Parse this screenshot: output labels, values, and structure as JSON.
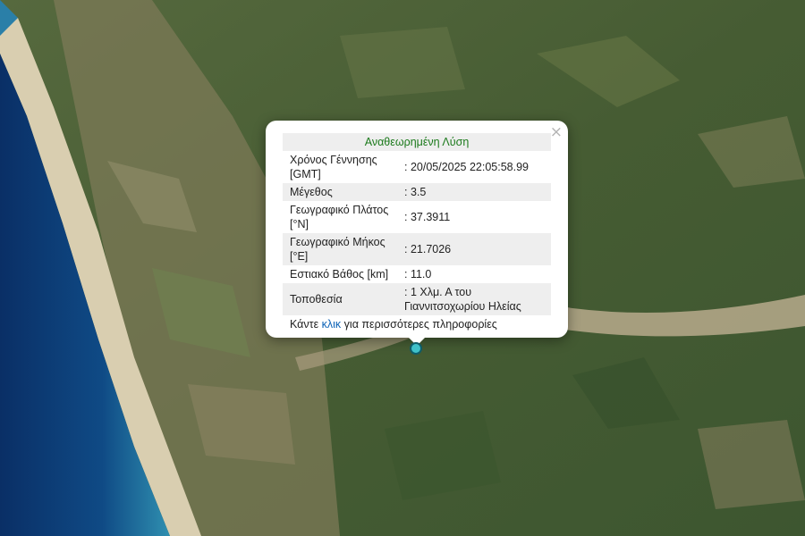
{
  "popup": {
    "title": "Αναθεωρημένη Λύση",
    "close_label": "×",
    "rows": [
      {
        "label": "Χρόνος Γέννησης [GMT]",
        "value": ": 20/05/2025 22:05:58.99"
      },
      {
        "label": "Μέγεθος",
        "value": ": 3.5"
      },
      {
        "label": "Γεωγραφικό Πλάτος [°N]",
        "value": ": 37.3911"
      },
      {
        "label": "Γεωγραφικό Μήκος [°E]",
        "value": ": 21.7026"
      },
      {
        "label": "Εστιακό Βάθος [km]",
        "value": ": 11.0"
      },
      {
        "label": "Τοποθεσία",
        "value": ": 1 Χλμ. Α του Γιαννιτσοχωρίου Ηλείας"
      }
    ],
    "more_prefix": "Κάντε ",
    "more_link": "κλικ",
    "more_suffix": " για περισσότερες πληροφορίες"
  },
  "colors": {
    "title": "#1c7a1c",
    "link": "#0b62b6",
    "marker_fill": "#3fc1c9",
    "sea": "#0d3f78",
    "land": "#4a5f35"
  },
  "marker": {
    "icon": "earthquake-epicenter-marker"
  }
}
